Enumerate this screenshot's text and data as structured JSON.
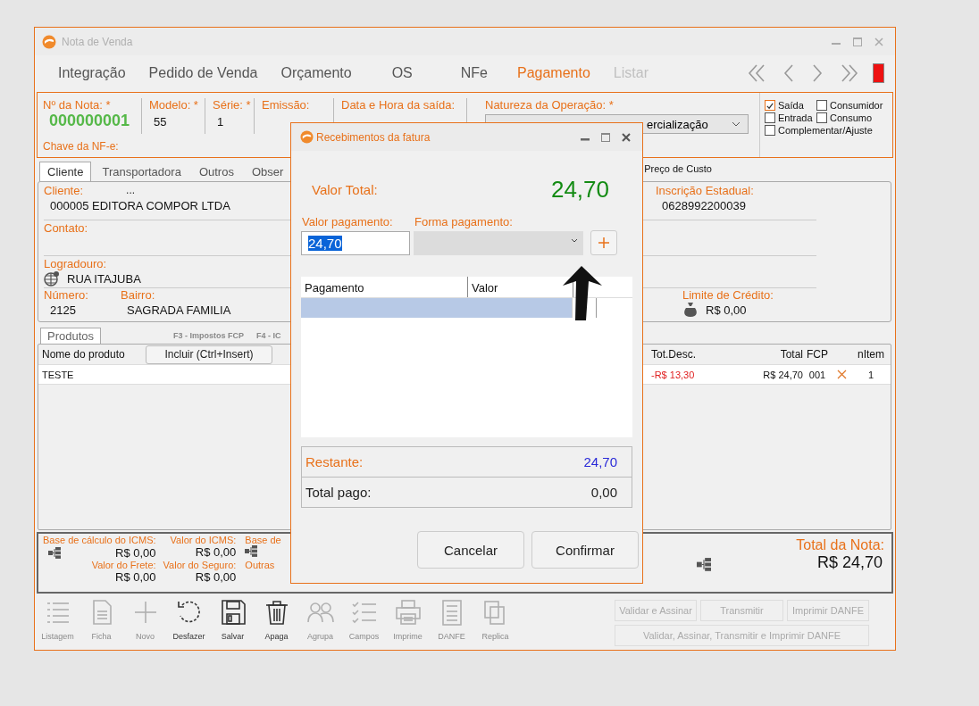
{
  "window": {
    "title": "Nota de Venda"
  },
  "nav": [
    {
      "label": "Integração",
      "selected": false,
      "disabled": false
    },
    {
      "label": "Pedido de Venda",
      "selected": false,
      "disabled": false
    },
    {
      "label": "Orçamento",
      "selected": false,
      "disabled": false
    },
    {
      "label": "OS",
      "selected": false,
      "disabled": false
    },
    {
      "label": "NFe",
      "selected": false,
      "disabled": false
    },
    {
      "label": "Pagamento",
      "selected": true,
      "disabled": false
    },
    {
      "label": "Listar",
      "selected": false,
      "disabled": true
    }
  ],
  "header": {
    "fields": [
      {
        "label": "Nº da Nota: *",
        "value": "000000001"
      },
      {
        "label": "Modelo: *",
        "value": "55"
      },
      {
        "label": "Série: *",
        "value": "1"
      },
      {
        "label": "Emissão:"
      },
      {
        "label": "Data e Hora da saída:"
      }
    ],
    "chave_label": "Chave da NF-e:",
    "natureza": {
      "label": "Natureza da Operação: *",
      "value": "ercialização"
    },
    "options": [
      {
        "label": "Saída",
        "checked": true
      },
      {
        "label": "Consumidor",
        "checked": false
      },
      {
        "label": "Entrada",
        "checked": false
      },
      {
        "label": "Consumo",
        "checked": false
      },
      {
        "label": "Complementar/Ajuste",
        "checked": false
      }
    ]
  },
  "tabs": [
    {
      "label": "Cliente",
      "selected": true
    },
    {
      "label": "Transportadora",
      "selected": false
    },
    {
      "label": "Outros",
      "selected": false
    },
    {
      "label": "Obser",
      "selected": false
    }
  ],
  "preco_custo": {
    "label": "Preço de Custo"
  },
  "cliente": {
    "cliente_label": "Cliente:",
    "cliente_search": "...",
    "cliente": "000005 EDITORA COMPOR LTDA",
    "contato_label": "Contato:",
    "logradouro_label": "Logradouro:",
    "logradouro": "RUA ITAJUBA",
    "numero_label": "Número:",
    "numero": "2125",
    "bairro_label": "Bairro:",
    "bairro": "SAGRADA FAMILIA",
    "ie_label": "Inscrição Estadual:",
    "ie": "0628992200039",
    "limite_label": "Limite de Crédito:",
    "limite": "R$ 0,00"
  },
  "produtos": {
    "tab": "Produtos",
    "hints": [
      "F3 - Impostos FCP",
      "F4 - IC"
    ],
    "name_column": "Nome do produto",
    "add_button": "Incluir (Ctrl+Insert)",
    "columns": [
      "Tot.Desc.",
      "Total",
      "FCP",
      "nItem"
    ],
    "rows": [
      {
        "name": "TESTE",
        "tot_desc": "-R$ 13,30",
        "total": "R$ 24,70",
        "fcp": "001",
        "nitem": "1"
      }
    ]
  },
  "totals": {
    "base_icms_label": "Base de cálculo do ICMS:",
    "base_icms": "R$ 0,00",
    "icms_label": "Valor do ICMS:",
    "icms": "R$ 0,00",
    "base_st_label": "Base de",
    "frete_label": "Valor do Frete:",
    "frete": "R$ 0,00",
    "seguro_label": "Valor do Seguro:",
    "seguro": "R$ 0,00",
    "outras_label": "Outras",
    "total_label": "Total da Nota:",
    "total": "R$ 24,70"
  },
  "toolbar": [
    {
      "label": "Listagem",
      "disabled": true
    },
    {
      "label": "Ficha",
      "disabled": true
    },
    {
      "label": "Novo",
      "disabled": true
    },
    {
      "label": "Desfazer",
      "disabled": false
    },
    {
      "label": "Salvar",
      "disabled": false
    },
    {
      "label": "Apaga",
      "disabled": false
    },
    {
      "label": "Agrupa",
      "disabled": true
    },
    {
      "label": "Campos",
      "disabled": true
    },
    {
      "label": "Imprime",
      "disabled": true
    },
    {
      "label": "DANFE",
      "disabled": true
    },
    {
      "label": "Replica",
      "disabled": true
    }
  ],
  "nfe_buttons": [
    {
      "label": "Validar e Assinar",
      "disabled": true
    },
    {
      "label": "Transmitir",
      "disabled": true
    },
    {
      "label": "Imprimir DANFE",
      "disabled": true
    },
    {
      "label": "Validar, Assinar, Transmitir e Imprimir DANFE",
      "disabled": true
    }
  ],
  "dialog": {
    "title": "Recebimentos da fatura",
    "total_label": "Valor Total:",
    "total": "24,70",
    "valor_label": "Valor pagamento:",
    "valor": "24,70",
    "forma_label": "Forma pagamento:",
    "columns": [
      "Pagamento",
      "Valor"
    ],
    "rows": [
      {
        "selected": true
      }
    ],
    "restante_label": "Restante:",
    "restante": "24,70",
    "pago_label": "Total pago:",
    "pago": "0,00",
    "buttons": [
      "Cancelar",
      "Confirmar"
    ]
  }
}
